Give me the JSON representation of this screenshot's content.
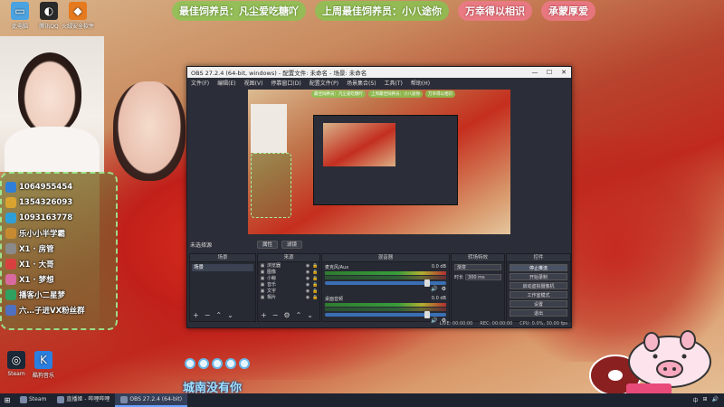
{
  "banner": {
    "best_feeder": "最佳饲养员：凡尘爱吃糖吖",
    "last_week_feeder": "上周最佳饲养员：小八途你",
    "pill1": "万幸得以相识",
    "pill2": "承蒙厚爱"
  },
  "desktop_icons": [
    {
      "label": "此电脑",
      "icon": "computer-icon",
      "color": "#4aa3e0",
      "glyph": "▭"
    },
    {
      "label": "腾讯QQ",
      "icon": "qq-penguin-icon",
      "color": "#2a2a2a",
      "glyph": "◐"
    },
    {
      "label": "火绒安全软件",
      "icon": "huorong-icon",
      "color": "#e67a1e",
      "glyph": "◆"
    }
  ],
  "desktop_icons_bottom": [
    {
      "label": "Steam",
      "icon": "steam-icon",
      "color": "#1b2838",
      "glyph": "◎"
    },
    {
      "label": "酷狗音乐",
      "icon": "kugou-icon",
      "color": "#2a7fe0",
      "glyph": "K"
    }
  ],
  "side_panel": {
    "rows": [
      {
        "text": "1064955454",
        "icon": "qq-icon",
        "color": "#2f7fd8"
      },
      {
        "text": "1354326093",
        "icon": "vip-icon",
        "color": "#d8a42f"
      },
      {
        "text": "1093163778",
        "icon": "browser-icon",
        "color": "#2f9fd8"
      },
      {
        "text": "乐小小半学霸",
        "icon": "owl-icon",
        "color": "#c88a30"
      },
      {
        "text": "X1 · 房管",
        "icon": "shield-icon",
        "color": "#8a8a8a"
      },
      {
        "text": "X1 · 大哥",
        "icon": "star-icon",
        "color": "#d84040"
      },
      {
        "text": "X1 · 梦想",
        "icon": "heart-icon",
        "color": "#d86aa0"
      },
      {
        "text": "播客小二星梦",
        "icon": "mic-icon",
        "color": "#30a060"
      },
      {
        "text": "六…子进VX粉丝群",
        "icon": "group-icon",
        "color": "#5070c0"
      }
    ]
  },
  "lyric": "城南没有你",
  "obs": {
    "title": "OBS 27.2.4 (64-bit, windows) - 配置文件: 未命名 - 场景: 未命名",
    "menu": [
      "文件(F)",
      "编辑(E)",
      "视图(V)",
      "停靠窗口(D)",
      "配置文件(P)",
      "场景集合(S)",
      "工具(T)",
      "帮助(H)"
    ],
    "preview_banner": [
      "最佳饲养员：凡尘爱吃糖吖",
      "上周最佳饲养员：小八途你",
      "万幸得以相识"
    ],
    "toolbar_label": "未选择源",
    "toolbar_buttons": [
      "属性",
      "滤镜"
    ],
    "docks": {
      "scenes": "场景",
      "sources": "来源",
      "mixer": "混音器",
      "transitions": "转场特效",
      "controls": "控件"
    },
    "scenes": [
      "场景"
    ],
    "sources": [
      "浏览器",
      "图像",
      "小鲸",
      "音乐",
      "文字",
      "相片"
    ],
    "mixer": [
      {
        "name": "麦克风/Aux",
        "db": "0.0 dB"
      },
      {
        "name": "桌面音频",
        "db": "0.0 dB"
      }
    ],
    "transitions": {
      "type": "渐变",
      "duration_label": "时长",
      "duration": "300 ms"
    },
    "controls": [
      "停止推流",
      "开始录制",
      "启动虚拟摄像机",
      "工作室模式",
      "设置",
      "退出"
    ],
    "status": [
      "LIVE: 00:00:00",
      "REC: 00:00:00",
      "CPU: 0.0%, 30.00 fps"
    ]
  },
  "taskbar": {
    "tasks": [
      {
        "label": "Steam",
        "active": false
      },
      {
        "label": "直播姬 - 哔哩哔哩",
        "active": false
      },
      {
        "label": "OBS 27.2.4 (64-bit)",
        "active": true
      }
    ],
    "tray": [
      "中",
      "⊞",
      "🔊"
    ]
  }
}
